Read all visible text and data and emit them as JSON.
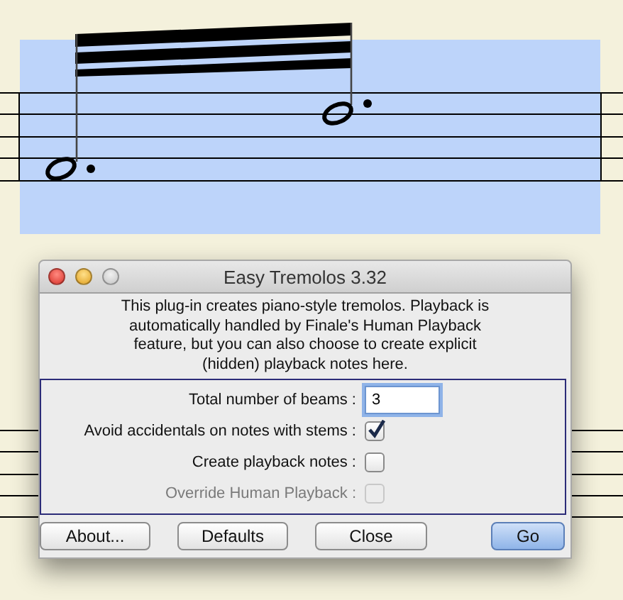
{
  "dialog": {
    "title": "Easy Tremolos 3.32",
    "window_controls": [
      {
        "kind": "close",
        "active": true
      },
      {
        "kind": "minimize",
        "active": true
      },
      {
        "kind": "zoom",
        "active": false
      }
    ],
    "description_lines": [
      "This plug-in creates piano-style tremolos. Playback is",
      "automatically handled by Finale's Human Playback",
      "feature, but you can also choose to create explicit",
      "(hidden) playback notes here."
    ],
    "fields": [
      {
        "kind": "text",
        "label": "Total number of beams :",
        "value": "3",
        "focused": true
      },
      {
        "kind": "checkbox",
        "label": "Avoid accidentals on notes with stems :",
        "checked": true,
        "disabled": false
      },
      {
        "kind": "checkbox",
        "label": "Create playback notes :",
        "checked": false,
        "disabled": false
      },
      {
        "kind": "checkbox",
        "label": "Override Human Playback :",
        "checked": false,
        "disabled": true
      }
    ],
    "buttons": [
      {
        "label": "About...",
        "default": false
      },
      {
        "label": "Defaults",
        "default": false
      },
      {
        "label": "Close",
        "default": false
      },
      {
        "label": "Go",
        "default": true
      }
    ]
  }
}
